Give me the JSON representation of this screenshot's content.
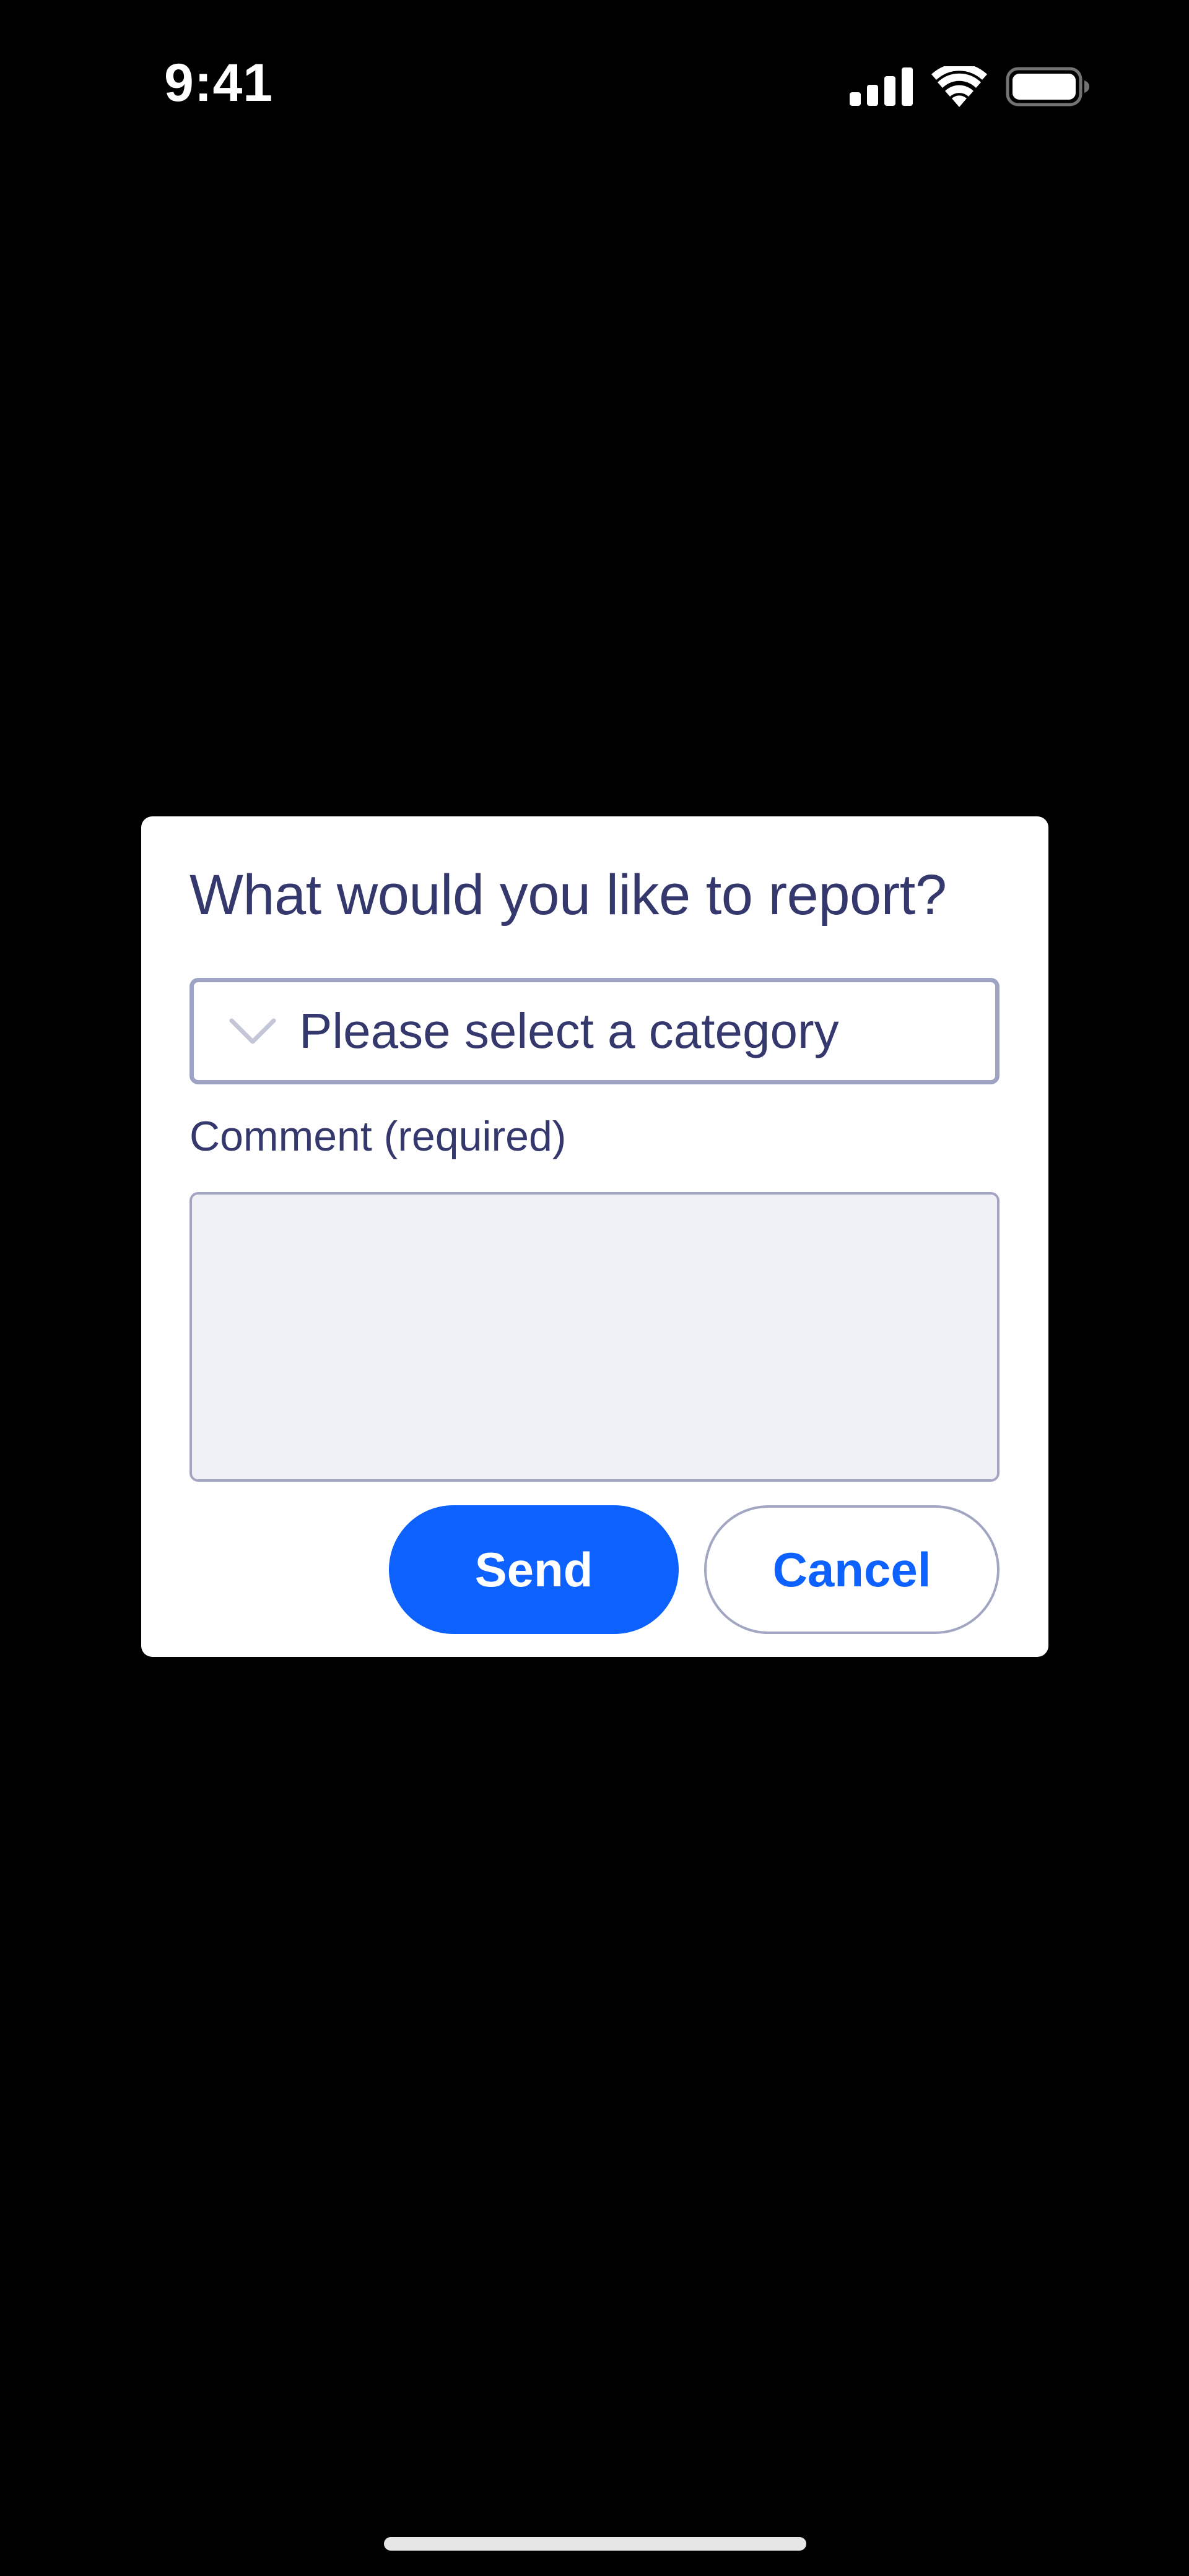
{
  "status_bar": {
    "time": "9:41",
    "icons": [
      "cellular-signal-icon",
      "wifi-icon",
      "battery-icon"
    ]
  },
  "dialog": {
    "title": "What would you like to report?",
    "category_select": {
      "placeholder": "Please select a category",
      "icon": "chevron-down-icon"
    },
    "comment_label": "Comment (required)",
    "comment_value": "",
    "send_label": "Send",
    "cancel_label": "Cancel"
  },
  "colors": {
    "background": "#000000",
    "dialog_background": "#ffffff",
    "text": "#35386c",
    "accent": "#0d62ff",
    "border": "#a2a6c2",
    "field_background": "#f0f1f6"
  }
}
